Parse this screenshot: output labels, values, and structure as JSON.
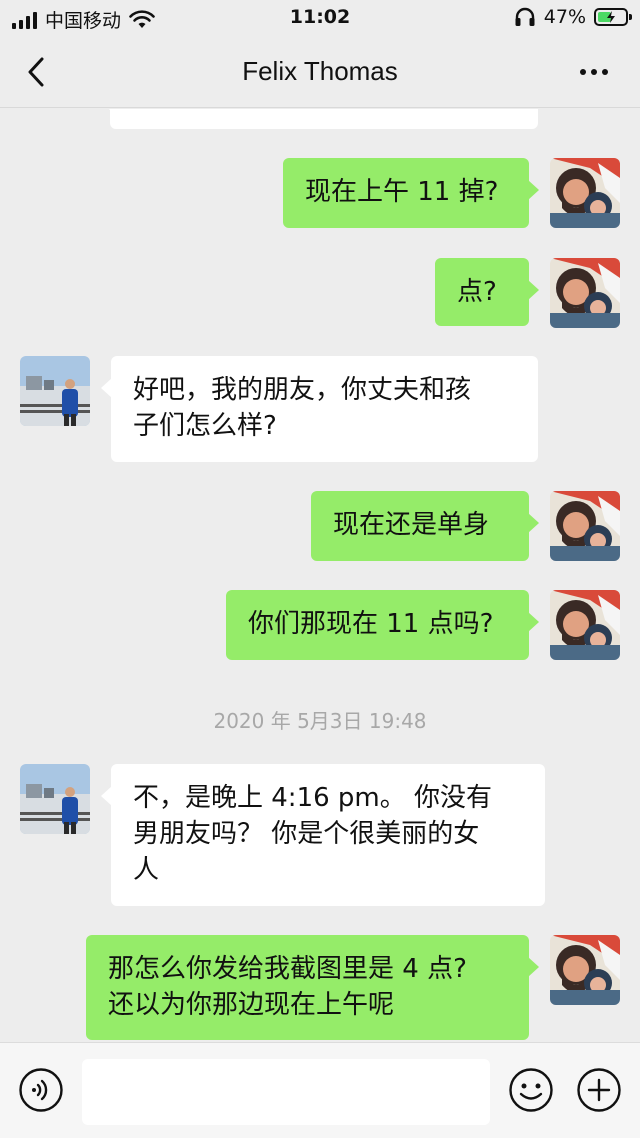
{
  "status_bar": {
    "carrier": "中国移动",
    "time": "11:02",
    "battery_percent": "47%",
    "icons": [
      "signal-icon",
      "wifi-icon",
      "headphones-icon",
      "battery-charging-icon"
    ]
  },
  "header": {
    "title": "Felix Thomas",
    "icons": [
      "back-chevron-icon",
      "more-dots-icon"
    ]
  },
  "messages": [
    {
      "side": "in",
      "text": "",
      "partial": true
    },
    {
      "side": "out",
      "lines": [
        "现在上午 11 掉?"
      ]
    },
    {
      "side": "out",
      "lines": [
        "点?"
      ]
    },
    {
      "side": "in",
      "lines": [
        "好吧，我的朋友，你丈夫和孩",
        "子们怎么样?"
      ]
    },
    {
      "side": "out",
      "lines": [
        "现在还是单身"
      ]
    },
    {
      "side": "out",
      "lines": [
        "你们那现在 11 点吗?"
      ]
    },
    {
      "timestamp": "2020 年 5月3日 19:48"
    },
    {
      "side": "in",
      "lines": [
        "不，是晚上 4:16 pm。 你没有",
        "男朋友吗？ 你是个很美丽的女",
        "人"
      ]
    },
    {
      "side": "out",
      "lines": [
        "那怎么你发给我截图里是 4 点?",
        "还以为你那边现在上午呢"
      ]
    }
  ],
  "input_bar": {
    "value": "",
    "icons": [
      "voice-icon",
      "emoji-icon",
      "plus-icon"
    ]
  },
  "colors": {
    "background": "#ededed",
    "outgoing_bubble": "#95ec69",
    "incoming_bubble": "#ffffff",
    "timestamp_text": "#a8a8a8"
  }
}
